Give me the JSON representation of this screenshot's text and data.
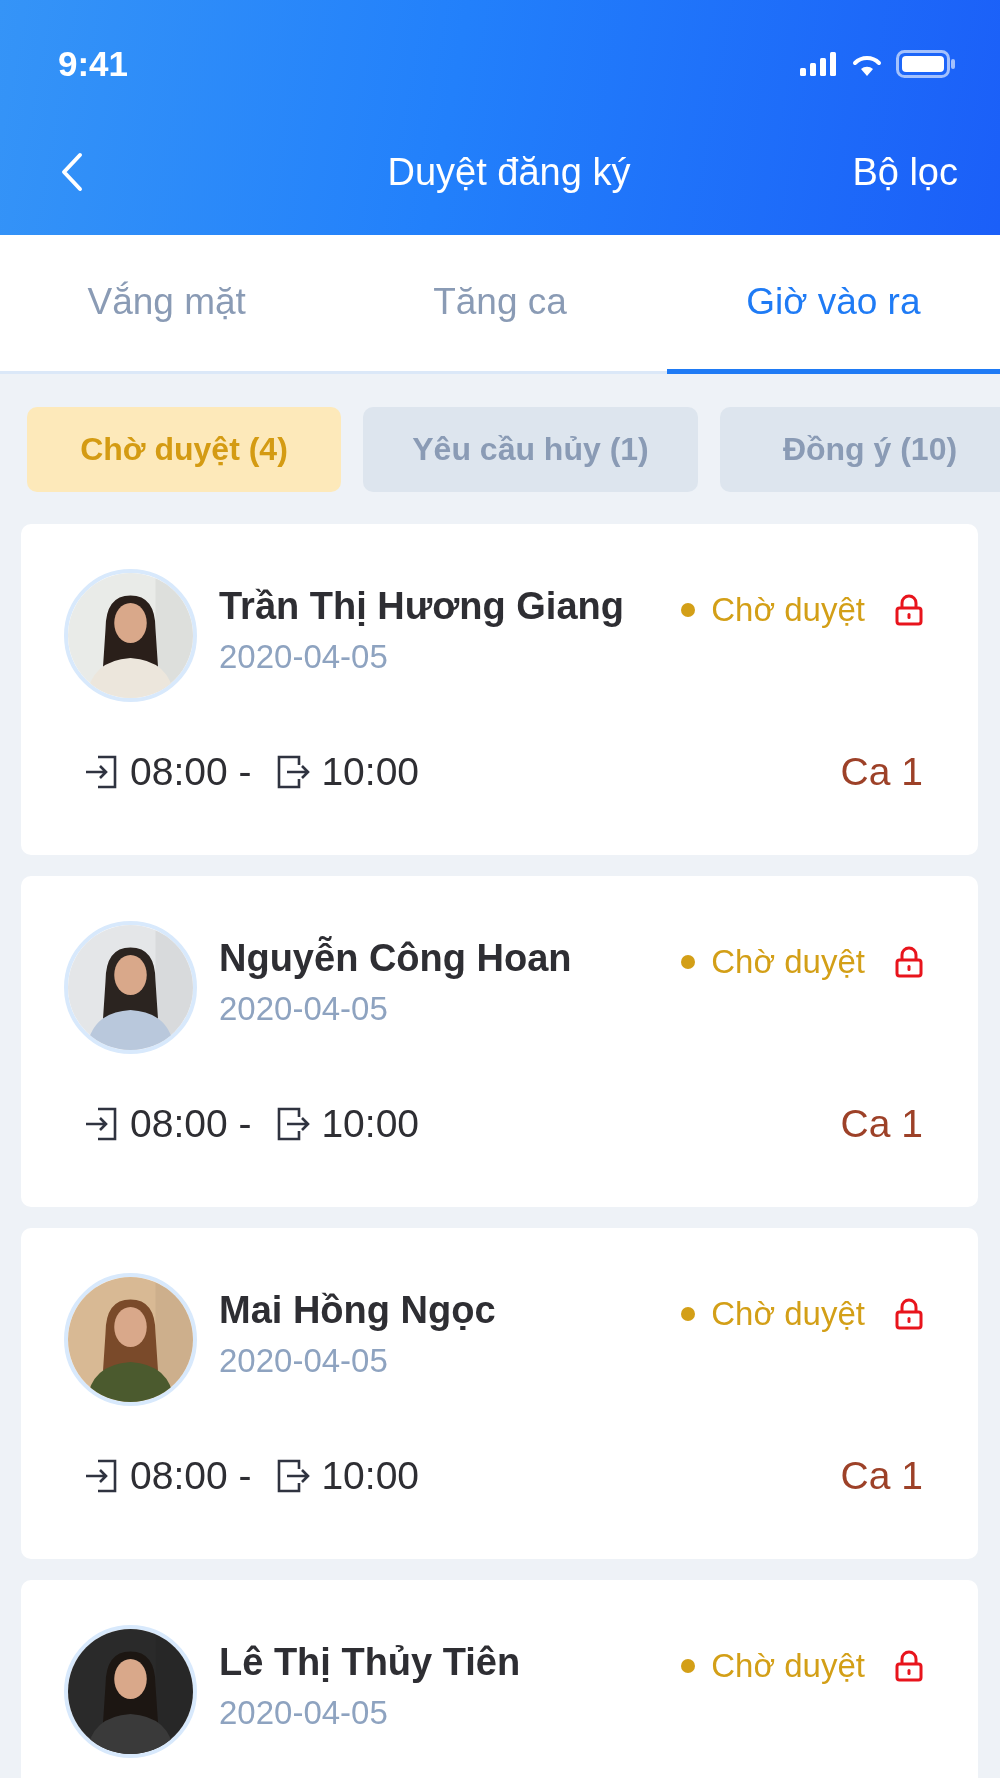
{
  "status_bar": {
    "time": "9:41"
  },
  "nav": {
    "title": "Duyệt đăng ký",
    "action": "Bộ lọc"
  },
  "tabs": [
    {
      "label": "Vắng mặt",
      "selected": false
    },
    {
      "label": "Tăng ca",
      "selected": false
    },
    {
      "label": "Giờ vào ra",
      "selected": true
    }
  ],
  "filters": [
    {
      "label": "Chờ duyệt (4)",
      "selected": true
    },
    {
      "label": "Yêu cầu hủy (1)",
      "selected": false
    },
    {
      "label": "Đồng ý (10)",
      "selected": false
    }
  ],
  "requests": [
    {
      "name": "Trần Thị Hương Giang",
      "date": "2020-04-05",
      "status": "Chờ duyệt",
      "locked": true,
      "check_in": "08:00 -",
      "check_out": "10:00",
      "shift": "Ca 1"
    },
    {
      "name": "Nguyễn Công Hoan",
      "date": "2020-04-05",
      "status": "Chờ duyệt",
      "locked": true,
      "check_in": "08:00 -",
      "check_out": "10:00",
      "shift": "Ca 1"
    },
    {
      "name": "Mai Hồng Ngọc",
      "date": "2020-04-05",
      "status": "Chờ duyệt",
      "locked": true,
      "check_in": "08:00 -",
      "check_out": "10:00",
      "shift": "Ca 1"
    },
    {
      "name": "Lê Thị Thủy Tiên",
      "date": "2020-04-05",
      "status": "Chờ duyệt",
      "locked": true
    }
  ]
}
